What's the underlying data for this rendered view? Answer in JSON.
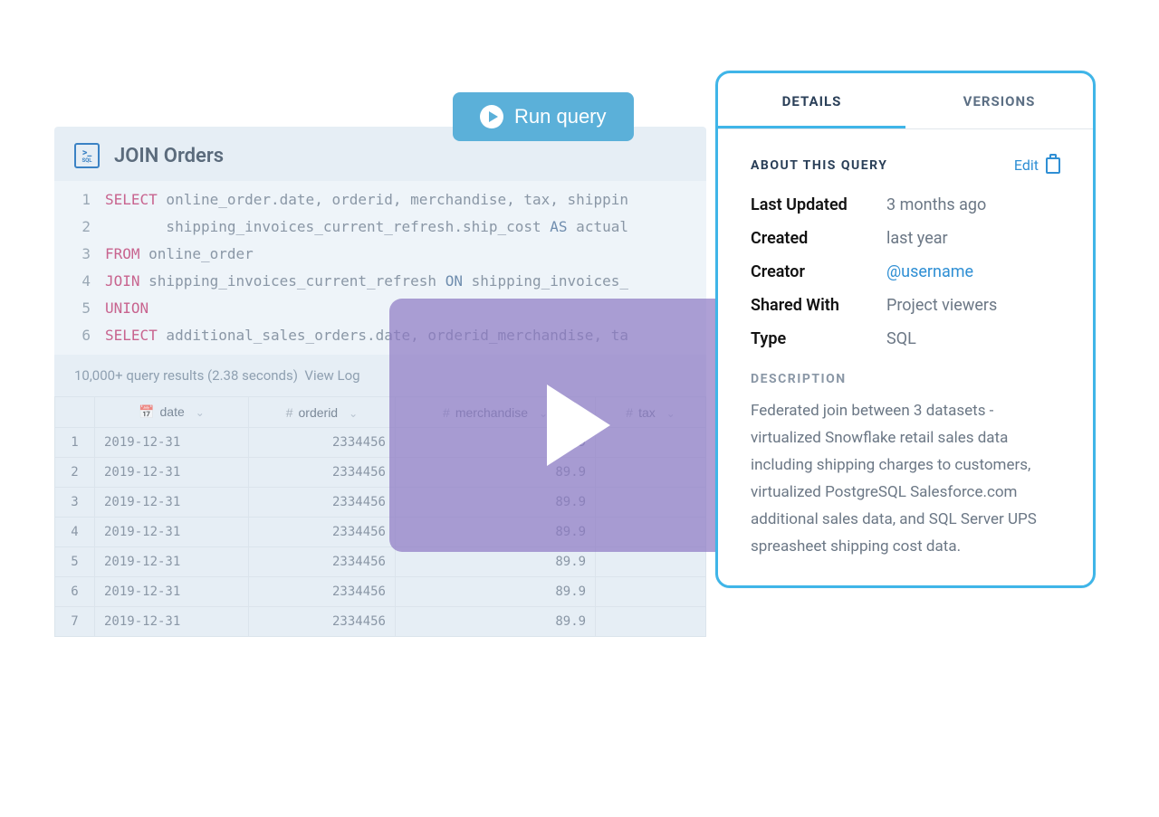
{
  "editor": {
    "title": "JOIN Orders",
    "lines": [
      {
        "n": "1",
        "pre": "",
        "kw": "SELECT",
        "rest": " online_order.date, orderid, merchandise, tax, shippin"
      },
      {
        "n": "2",
        "pre": "       ",
        "kw": "",
        "rest": "shipping_invoices_current_refresh.ship_cost ",
        "kw2": "AS",
        "rest2": " actual"
      },
      {
        "n": "3",
        "pre": "",
        "kw": "FROM",
        "rest": " online_order"
      },
      {
        "n": "4",
        "pre": "",
        "kw": "JOIN",
        "rest": " shipping_invoices_current_refresh ",
        "kw2": "ON",
        "rest2": " shipping_invoices_"
      },
      {
        "n": "5",
        "pre": "",
        "kw": "UNION",
        "rest": ""
      },
      {
        "n": "6",
        "pre": "",
        "kw": "SELECT",
        "rest": " additional_sales_orders.date, orderid_merchandise, ta"
      }
    ]
  },
  "results": {
    "summary": "10,000+ query results (2.38 seconds)",
    "viewlog": "View Log",
    "columns": [
      "date",
      "orderid",
      "merchandise",
      "tax"
    ],
    "rows": [
      {
        "n": "1",
        "date": "2019-12-31",
        "orderid": "2334456",
        "merchandise": "89.9",
        "tax": ""
      },
      {
        "n": "2",
        "date": "2019-12-31",
        "orderid": "2334456",
        "merchandise": "89.9",
        "tax": ""
      },
      {
        "n": "3",
        "date": "2019-12-31",
        "orderid": "2334456",
        "merchandise": "89.9",
        "tax": ""
      },
      {
        "n": "4",
        "date": "2019-12-31",
        "orderid": "2334456",
        "merchandise": "89.9",
        "tax": ""
      },
      {
        "n": "5",
        "date": "2019-12-31",
        "orderid": "2334456",
        "merchandise": "89.9",
        "tax": ""
      },
      {
        "n": "6",
        "date": "2019-12-31",
        "orderid": "2334456",
        "merchandise": "89.9",
        "tax": ""
      },
      {
        "n": "7",
        "date": "2019-12-31",
        "orderid": "2334456",
        "merchandise": "89.9",
        "tax": ""
      }
    ]
  },
  "run_button": "Run query",
  "details": {
    "tabs": {
      "details": "DETAILS",
      "versions": "VERSIONS"
    },
    "about_title": "ABOUT THIS QUERY",
    "edit_label": "Edit",
    "meta": {
      "last_updated_label": "Last Updated",
      "last_updated": "3 months ago",
      "created_label": "Created",
      "created": "last year",
      "creator_label": "Creator",
      "creator": "@username",
      "shared_label": "Shared With",
      "shared": "Project viewers",
      "type_label": "Type",
      "type": "SQL"
    },
    "description_title": "DESCRIPTION",
    "description": "Federated join between 3 datasets - virtualized Snowflake retail sales data including shipping charges to customers, virtualized PostgreSQL Salesforce.com additional sales data, and SQL Server UPS spreasheet shipping cost data."
  }
}
